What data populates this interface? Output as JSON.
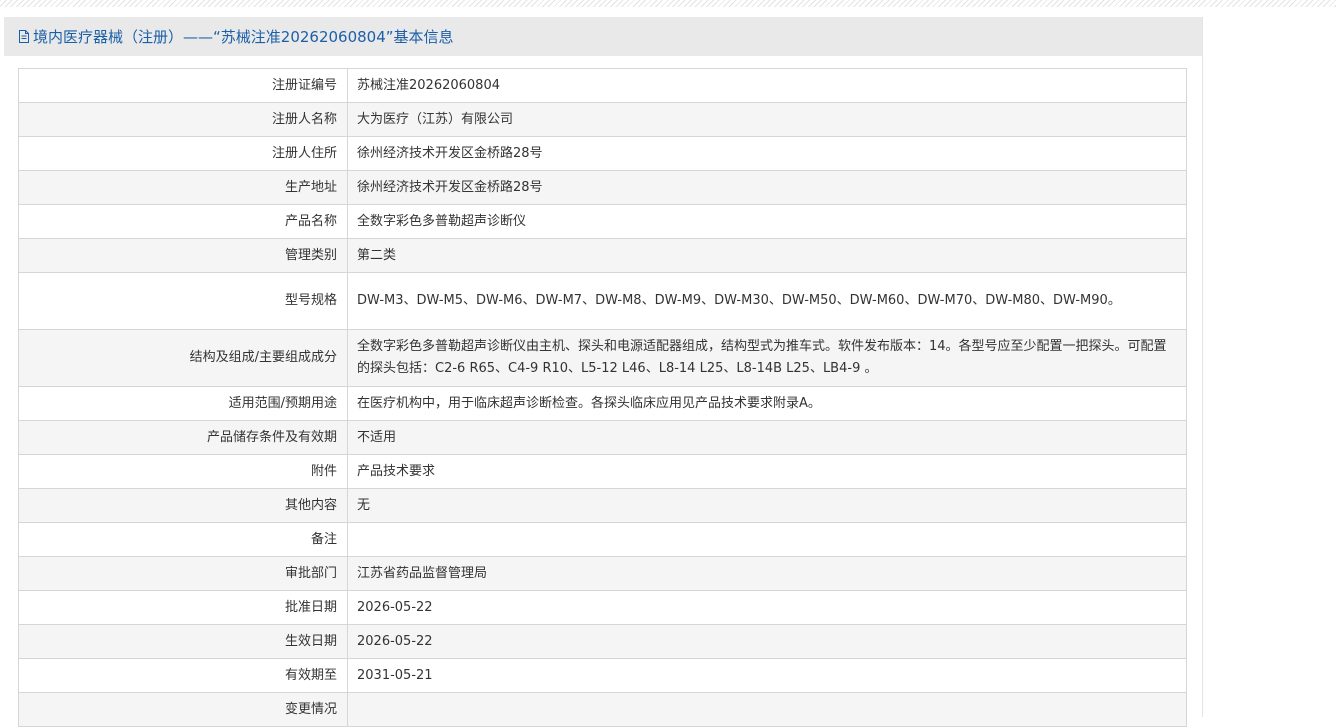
{
  "header": {
    "title": "境内医疗器械（注册）——“苏械注准20262060804”基本信息",
    "icon": "document-icon",
    "color": "#1b5fa8"
  },
  "rows": [
    {
      "label": "注册证编号",
      "value": "苏械注准20262060804"
    },
    {
      "label": "注册人名称",
      "value": "大为医疗（江苏）有限公司"
    },
    {
      "label": "注册人住所",
      "value": "徐州经济技术开发区金桥路28号"
    },
    {
      "label": "生产地址",
      "value": "徐州经济技术开发区金桥路28号"
    },
    {
      "label": "产品名称",
      "value": "全数字彩色多普勒超声诊断仪"
    },
    {
      "label": "管理类别",
      "value": "第二类"
    },
    {
      "label": "型号规格",
      "value": "DW-M3、DW-M5、DW-M6、DW-M7、DW-M8、DW-M9、DW-M30、DW-M50、DW-M60、DW-M70、DW-M80、DW-M90。"
    },
    {
      "label": "结构及组成/主要组成成分",
      "value": "全数字彩色多普勒超声诊断仪由主机、探头和电源适配器组成，结构型式为推车式。软件发布版本：14。各型号应至少配置一把探头。可配置的探头包括：C2-6 R65、C4-9 R10、L5-12 L46、L8-14 L25、L8-14B L25、LB4-9 。"
    },
    {
      "label": "适用范围/预期用途",
      "value": "在医疗机构中，用于临床超声诊断检查。各探头临床应用见产品技术要求附录A。"
    },
    {
      "label": "产品储存条件及有效期",
      "value": "不适用"
    },
    {
      "label": "附件",
      "value": "产品技术要求"
    },
    {
      "label": "其他内容",
      "value": "无"
    },
    {
      "label": "备注",
      "value": ""
    },
    {
      "label": "审批部门",
      "value": "江苏省药品监督管理局"
    },
    {
      "label": "批准日期",
      "value": "2026-05-22"
    },
    {
      "label": "生效日期",
      "value": "2026-05-22"
    },
    {
      "label": "有效期至",
      "value": "2031-05-21"
    },
    {
      "label": "变更情况",
      "value": ""
    }
  ]
}
